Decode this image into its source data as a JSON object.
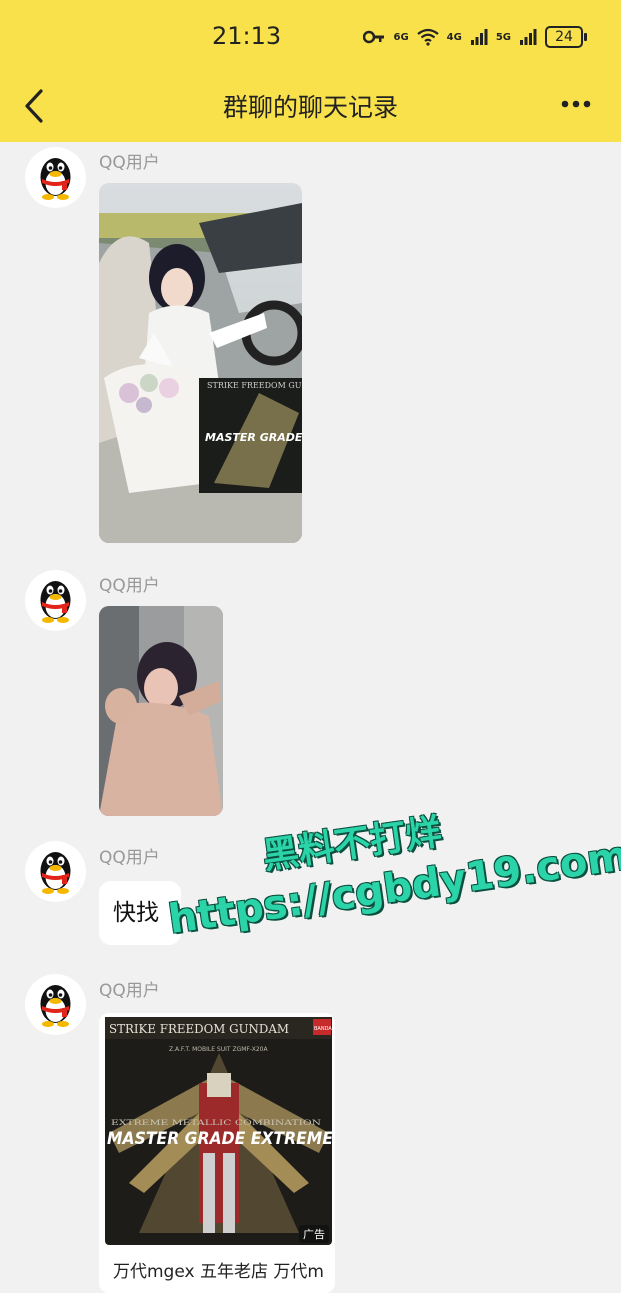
{
  "status_bar": {
    "time": "21:13",
    "signal_1": "6G",
    "signal_2": "4G",
    "signal_3": "5G",
    "battery": "24"
  },
  "nav": {
    "title": "群聊的聊天记录",
    "back_icon": "chevron-left-icon",
    "more_icon": "more-horizontal-icon"
  },
  "messages": [
    {
      "sender": "QQ用户",
      "type": "image",
      "avatar_icon": "qq-penguin-icon"
    },
    {
      "sender": "QQ用户",
      "type": "image",
      "avatar_icon": "qq-penguin-icon"
    },
    {
      "sender": "QQ用户",
      "type": "text",
      "text": "快找",
      "avatar_icon": "qq-penguin-icon"
    },
    {
      "sender": "QQ用户",
      "type": "ad",
      "ad_tag": "广告",
      "ad_text": "万代mgex 五年老店 万代m",
      "avatar_icon": "qq-penguin-icon",
      "box_title": "STRIKE FREEDOM GUNDAM",
      "box_subtitle": "Z.A.F.T. MOBILE SUIT ZGMF-X20A",
      "box_band": "EXTREME METALLIC COMBINATION",
      "box_grade": "MASTER GRADE EXTREME",
      "brand": "BANDAI"
    }
  ],
  "photo_1_labels": {
    "box_title": "STRIKE FREEDOM GUNDAM",
    "box_grade": "MASTER GRADE EX"
  },
  "watermark": {
    "line1": "黑料不打烊",
    "line2": "https://cgbdy19.com"
  },
  "colors": {
    "header_yellow": "#f9e14b",
    "background": "#f1f1f1",
    "watermark_green": "#2bd4a8"
  }
}
